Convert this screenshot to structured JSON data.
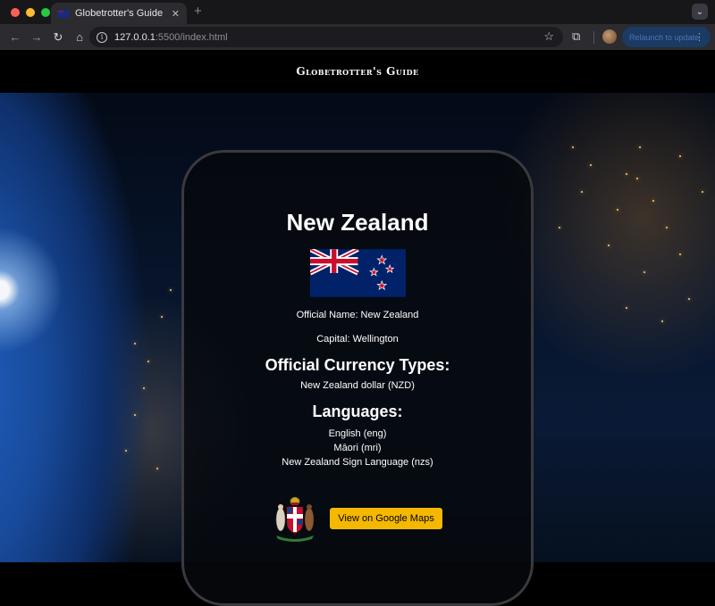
{
  "browser": {
    "tab_title": "Globetrotter's Guide",
    "tab_close": "✕",
    "new_tab": "+",
    "url_host": "127.0.0.1",
    "url_path": ":5500/index.html",
    "relaunch_label": "Relaunch to update"
  },
  "site": {
    "title": "Globetrotter's Guide"
  },
  "country": {
    "name": "New Zealand",
    "official_name": "Official Name: New Zealand",
    "capital": "Capital: Wellington",
    "currency_heading": "Official Currency Types:",
    "currencies": [
      "New Zealand dollar (NZD)"
    ],
    "languages_heading": "Languages:",
    "languages": [
      "English (eng)",
      "Māori (mri)",
      "New Zealand Sign Language (nzs)"
    ],
    "maps_button": "View on Google Maps"
  },
  "colors": {
    "accent_button": "#f5b800",
    "flag_blue": "#012169",
    "flag_red": "#c8102e"
  }
}
